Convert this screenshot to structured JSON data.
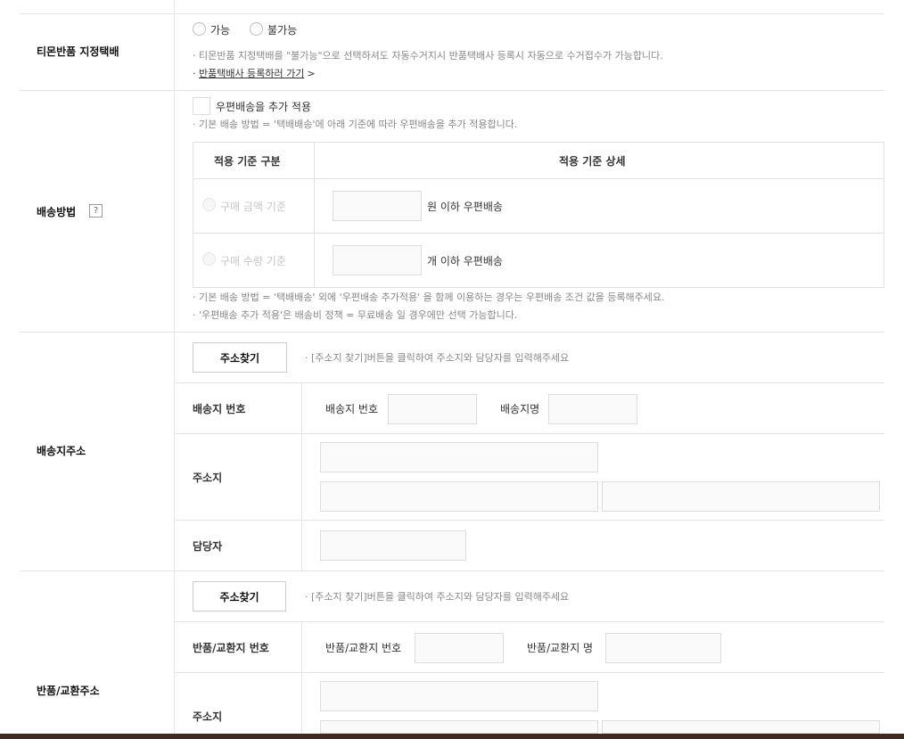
{
  "return_courier": {
    "label": "티몬반품 지정택배",
    "options": [
      "가능",
      "불가능"
    ],
    "note": "· 티몬반품 지정택배를 \"불가능\"으로 선택하셔도 자동수거지시 반품택배사 등록시 자동으로 수거접수가 가능합니다.",
    "link_prefix": "· ",
    "link_text": "반품택배사 등록하러 가기",
    "link_arrow": ">"
  },
  "delivery_method": {
    "label": "배송방법",
    "help": "?",
    "checkbox_label": "우편배송을 추가 적용",
    "note1": "· 기본 배송 방법 = '택배배송'에 아래 기준에 따라 우편배송을 추가 적용합니다.",
    "table_header": [
      "적용 기준 구분",
      "적용 기준 상세"
    ],
    "rows": [
      {
        "option": "구매 금액 기준",
        "suffix": "원 이하 우편배송"
      },
      {
        "option": "구매 수량 기준",
        "suffix": "개 이하 우편배송"
      }
    ],
    "note2": "· 기본 배송 방법 = '택배배송' 외에 '우편배송 추가적용' 을 함께 이용하는 경우는 우편배송 조건 값을 등록해주세요.",
    "note3": "· '우편배송 추가 적용'은 배송비 정책 = 무료배송 일 경우에만 선택 가능합니다."
  },
  "shipping_address": {
    "label": "배송지주소",
    "find_button": "주소찾기",
    "hint": "· [주소지 찾기]버튼을 클릭하여 주소지와 담당자를 입력해주세요",
    "number_label": "배송지 번호",
    "number_field_label": "배송지 번호",
    "name_field_label": "배송지명",
    "address_label": "주소지",
    "manager_label": "담당자"
  },
  "return_address": {
    "label": "반품/교환주소",
    "find_button": "주소찾기",
    "hint": "· [주소지 찾기]버튼을 클릭하여 주소지와 담당자를 입력해주세요",
    "number_label": "반품/교환지 번호",
    "number_field_label": "반품/교환지 번호",
    "name_field_label": "반품/교환지 명",
    "address_label": "주소지"
  }
}
